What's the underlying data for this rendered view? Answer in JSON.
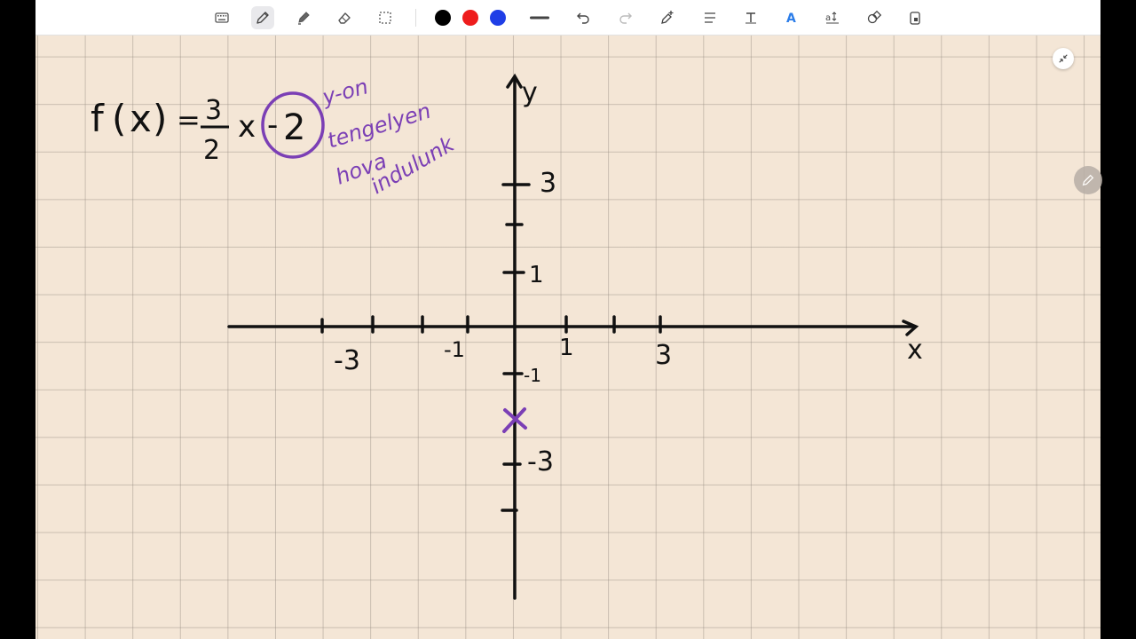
{
  "colors": {
    "black": "#000000",
    "red": "#ee1c1c",
    "blue": "#1f3ee6",
    "annotation": "#7b3fb5"
  },
  "toolbar": {
    "tools": [
      "keyboard-icon",
      "pen-icon",
      "highlighter-icon",
      "eraser-icon",
      "lasso-icon"
    ],
    "swatches": [
      "#000000",
      "#ee1c1c",
      "#1f3ee6"
    ]
  },
  "math": {
    "f": "f",
    "open_paren": "(",
    "x": "x",
    "close_paren": ")",
    "eq": "=",
    "frac_num": "3",
    "frac_den": "2",
    "x2": "x",
    "minus": "-",
    "circled": "2"
  },
  "annotation": {
    "line1": "y-on",
    "line2": "tengelyen",
    "line3": "hova",
    "line4": "indulunk"
  },
  "axes": {
    "x_label": "x",
    "y_label": "y",
    "x_ticks": [
      "-3",
      "-1",
      "1",
      "3"
    ],
    "y_ticks": [
      "3",
      "1",
      "-1",
      "-3"
    ]
  },
  "point": {
    "marker": "×"
  }
}
